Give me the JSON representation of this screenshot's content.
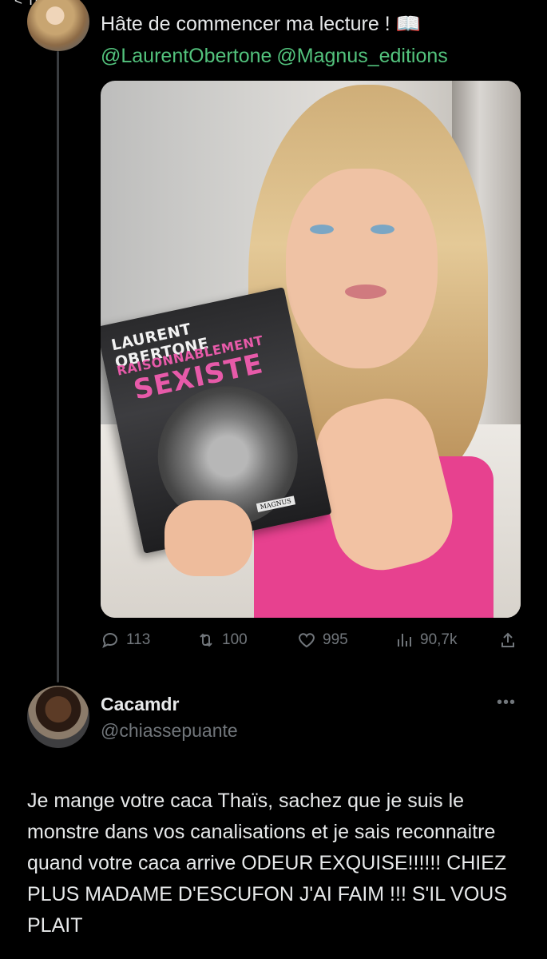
{
  "nav": {
    "back_label": "< TikTok"
  },
  "tweet": {
    "text": "Hâte de commencer ma lecture ! 📖",
    "mentions": [
      "@LaurentObertone",
      "@Magnus_editions"
    ],
    "book": {
      "author": "LAURENT OBERTONE",
      "subtitle": "RAISONNABLEMENT",
      "title": "SEXISTE",
      "publisher": "MAGNUS"
    },
    "stats": {
      "replies": "113",
      "retweets": "100",
      "likes": "995",
      "views": "90,7k"
    }
  },
  "reply": {
    "name": "Cacamdr",
    "handle": "@chiassepuante",
    "more": "•••",
    "text": "Je mange votre caca Thaïs, sachez que je suis le monstre dans vos canalisations et je sais reconnaitre quand votre caca arrive ODEUR EXQUISE!!!!!! CHIEZ PLUS MADAME D'ESCUFON J'AI FAIM !!! S'IL VOUS PLAIT"
  },
  "colors": {
    "background": "#000000",
    "text": "#e7e9ea",
    "muted": "#71767b",
    "mention": "#53c37d"
  },
  "icons": [
    "reply-icon",
    "retweet-icon",
    "like-icon",
    "views-icon",
    "share-icon"
  ]
}
